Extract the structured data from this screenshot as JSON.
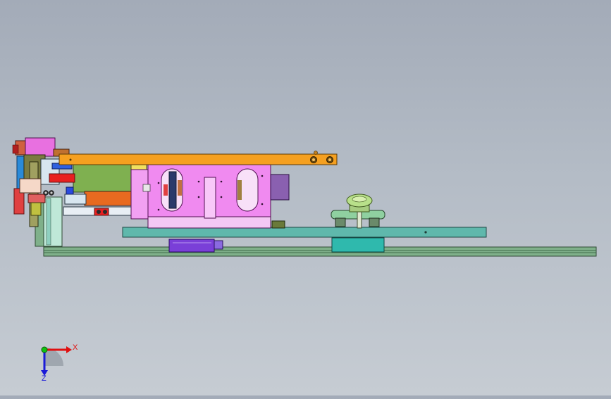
{
  "viewport": {
    "background_top": "#a3abb8",
    "background_bottom": "#c6ccd3"
  },
  "triad": {
    "x_label": "X",
    "z_label": "Z",
    "x_color": "#e01010",
    "z_color": "#1a1ad8",
    "y_color": "#10c010"
  },
  "model": {
    "colors": {
      "rail": "#7fb08a",
      "base_plate": "#5fb8ac",
      "carriage_block": "#2fb9ad",
      "slide_block": "#7a3fd8",
      "pink_housing": "#f08af0",
      "orange_arm": "#f5a020",
      "olive_block": "#7fb050",
      "red_bar": "#e82020",
      "orange_cylinder": "#e86a20",
      "knob": "#b8e08a",
      "purple_motor": "#8a60b0"
    }
  }
}
